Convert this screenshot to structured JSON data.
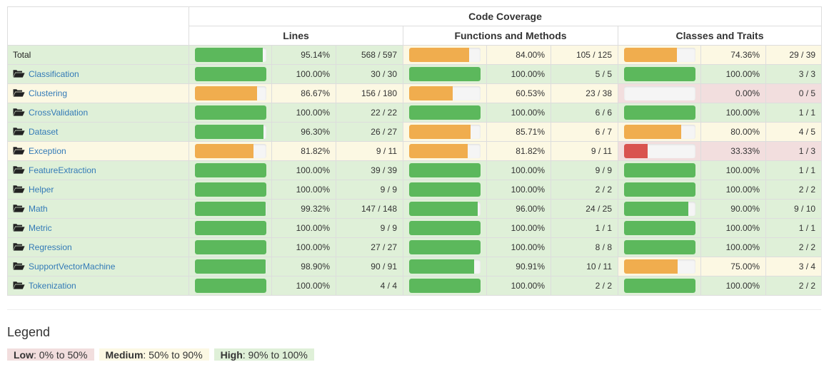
{
  "header": {
    "title": "Code Coverage",
    "col_lines": "Lines",
    "col_functions": "Functions and Methods",
    "col_classes": "Classes and Traits"
  },
  "colors": {
    "success_bar": "#5cb85c",
    "warning_bar": "#f0ad4e",
    "danger_bar": "#d9534f",
    "success_bg": "#dff0d8",
    "warning_bg": "#fcf8e3",
    "danger_bg": "#f2dede",
    "link": "#337ab7"
  },
  "rows": [
    {
      "name": "Total",
      "is_total": true,
      "icon": "",
      "lines": {
        "value": 95.14,
        "pct": "95.14%",
        "count": "568 / 597",
        "level": "success"
      },
      "functions": {
        "value": 84.0,
        "pct": "84.00%",
        "count": "105 / 125",
        "level": "warning"
      },
      "classes": {
        "value": 74.36,
        "pct": "74.36%",
        "count": "29 / 39",
        "level": "warning"
      }
    },
    {
      "name": "Classification",
      "is_total": false,
      "icon": "folder-open-icon",
      "lines": {
        "value": 100,
        "pct": "100.00%",
        "count": "30 / 30",
        "level": "success"
      },
      "functions": {
        "value": 100,
        "pct": "100.00%",
        "count": "5 / 5",
        "level": "success"
      },
      "classes": {
        "value": 100,
        "pct": "100.00%",
        "count": "3 / 3",
        "level": "success"
      }
    },
    {
      "name": "Clustering",
      "is_total": false,
      "icon": "folder-open-icon",
      "lines": {
        "value": 86.67,
        "pct": "86.67%",
        "count": "156 / 180",
        "level": "warning"
      },
      "functions": {
        "value": 60.53,
        "pct": "60.53%",
        "count": "23 / 38",
        "level": "warning"
      },
      "classes": {
        "value": 0,
        "pct": "0.00%",
        "count": "0 / 5",
        "level": "danger"
      }
    },
    {
      "name": "CrossValidation",
      "is_total": false,
      "icon": "folder-open-icon",
      "lines": {
        "value": 100,
        "pct": "100.00%",
        "count": "22 / 22",
        "level": "success"
      },
      "functions": {
        "value": 100,
        "pct": "100.00%",
        "count": "6 / 6",
        "level": "success"
      },
      "classes": {
        "value": 100,
        "pct": "100.00%",
        "count": "1 / 1",
        "level": "success"
      }
    },
    {
      "name": "Dataset",
      "is_total": false,
      "icon": "folder-open-icon",
      "lines": {
        "value": 96.3,
        "pct": "96.30%",
        "count": "26 / 27",
        "level": "success"
      },
      "functions": {
        "value": 85.71,
        "pct": "85.71%",
        "count": "6 / 7",
        "level": "warning"
      },
      "classes": {
        "value": 80.0,
        "pct": "80.00%",
        "count": "4 / 5",
        "level": "warning"
      }
    },
    {
      "name": "Exception",
      "is_total": false,
      "icon": "folder-open-icon",
      "lines": {
        "value": 81.82,
        "pct": "81.82%",
        "count": "9 / 11",
        "level": "warning"
      },
      "functions": {
        "value": 81.82,
        "pct": "81.82%",
        "count": "9 / 11",
        "level": "warning"
      },
      "classes": {
        "value": 33.33,
        "pct": "33.33%",
        "count": "1 / 3",
        "level": "danger"
      }
    },
    {
      "name": "FeatureExtraction",
      "is_total": false,
      "icon": "folder-open-icon",
      "lines": {
        "value": 100,
        "pct": "100.00%",
        "count": "39 / 39",
        "level": "success"
      },
      "functions": {
        "value": 100,
        "pct": "100.00%",
        "count": "9 / 9",
        "level": "success"
      },
      "classes": {
        "value": 100,
        "pct": "100.00%",
        "count": "1 / 1",
        "level": "success"
      }
    },
    {
      "name": "Helper",
      "is_total": false,
      "icon": "folder-open-icon",
      "lines": {
        "value": 100,
        "pct": "100.00%",
        "count": "9 / 9",
        "level": "success"
      },
      "functions": {
        "value": 100,
        "pct": "100.00%",
        "count": "2 / 2",
        "level": "success"
      },
      "classes": {
        "value": 100,
        "pct": "100.00%",
        "count": "2 / 2",
        "level": "success"
      }
    },
    {
      "name": "Math",
      "is_total": false,
      "icon": "folder-open-icon",
      "lines": {
        "value": 99.32,
        "pct": "99.32%",
        "count": "147 / 148",
        "level": "success"
      },
      "functions": {
        "value": 96.0,
        "pct": "96.00%",
        "count": "24 / 25",
        "level": "success"
      },
      "classes": {
        "value": 90.0,
        "pct": "90.00%",
        "count": "9 / 10",
        "level": "success"
      }
    },
    {
      "name": "Metric",
      "is_total": false,
      "icon": "folder-open-icon",
      "lines": {
        "value": 100,
        "pct": "100.00%",
        "count": "9 / 9",
        "level": "success"
      },
      "functions": {
        "value": 100,
        "pct": "100.00%",
        "count": "1 / 1",
        "level": "success"
      },
      "classes": {
        "value": 100,
        "pct": "100.00%",
        "count": "1 / 1",
        "level": "success"
      }
    },
    {
      "name": "Regression",
      "is_total": false,
      "icon": "folder-open-icon",
      "lines": {
        "value": 100,
        "pct": "100.00%",
        "count": "27 / 27",
        "level": "success"
      },
      "functions": {
        "value": 100,
        "pct": "100.00%",
        "count": "8 / 8",
        "level": "success"
      },
      "classes": {
        "value": 100,
        "pct": "100.00%",
        "count": "2 / 2",
        "level": "success"
      }
    },
    {
      "name": "SupportVectorMachine",
      "is_total": false,
      "icon": "folder-open-icon",
      "lines": {
        "value": 98.9,
        "pct": "98.90%",
        "count": "90 / 91",
        "level": "success"
      },
      "functions": {
        "value": 90.91,
        "pct": "90.91%",
        "count": "10 / 11",
        "level": "success"
      },
      "classes": {
        "value": 75.0,
        "pct": "75.00%",
        "count": "3 / 4",
        "level": "warning"
      }
    },
    {
      "name": "Tokenization",
      "is_total": false,
      "icon": "folder-open-icon",
      "lines": {
        "value": 100,
        "pct": "100.00%",
        "count": "4 / 4",
        "level": "success"
      },
      "functions": {
        "value": 100,
        "pct": "100.00%",
        "count": "2 / 2",
        "level": "success"
      },
      "classes": {
        "value": 100,
        "pct": "100.00%",
        "count": "2 / 2",
        "level": "success"
      }
    }
  ],
  "legend": {
    "title": "Legend",
    "low_label": "Low",
    "low_range": ": 0% to 50%",
    "medium_label": "Medium",
    "medium_range": ": 50% to 90%",
    "high_label": "High",
    "high_range": ": 90% to 100%"
  }
}
